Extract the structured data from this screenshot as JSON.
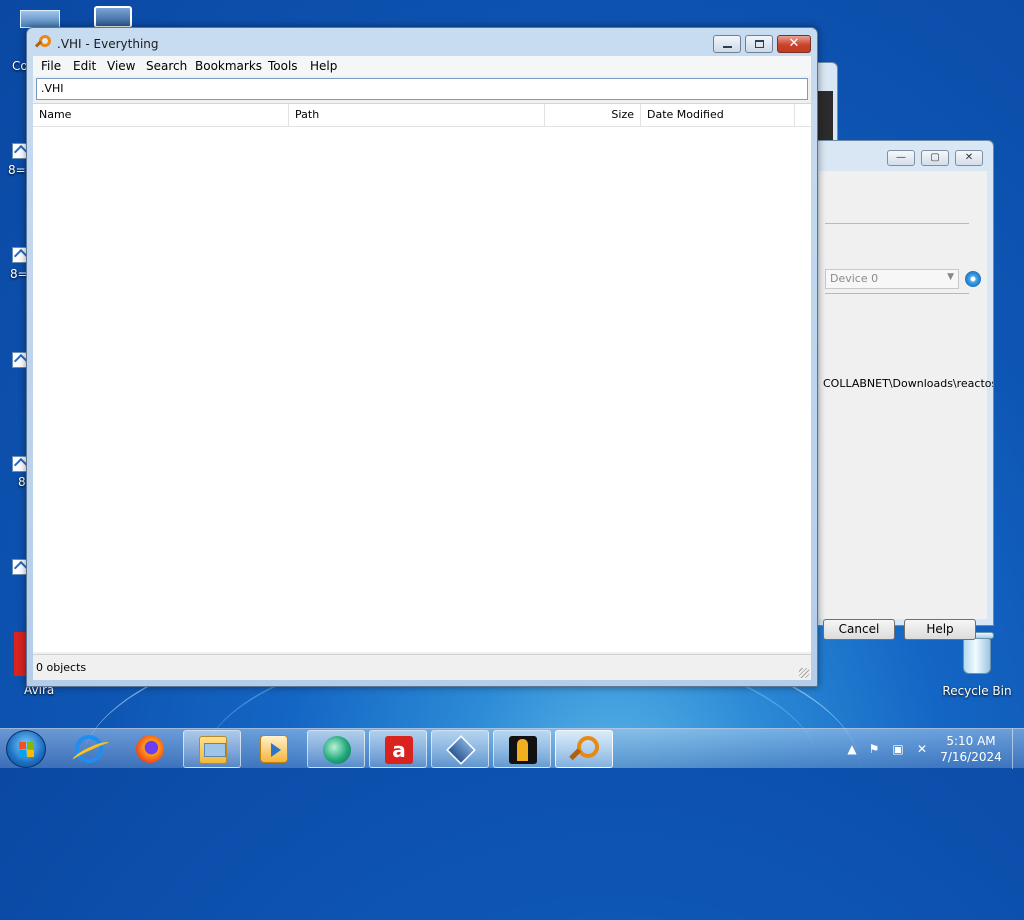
{
  "window": {
    "title": ".VHI - Everything",
    "menu": [
      "File",
      "Edit",
      "View",
      "Search",
      "Bookmarks",
      "Tools",
      "Help"
    ],
    "search_value": ".VHI",
    "columns": [
      "Name",
      "Path",
      "Size",
      "Date Modified"
    ],
    "status": "0 objects"
  },
  "background_dialog": {
    "device_combo": "Device 0",
    "path_text": "COLLABNET\\Downloads\\reactos...",
    "cancel_label": "Cancel",
    "help_label": "Help"
  },
  "desktop": {
    "recycle_bin_label": "Recycle Bin",
    "left_labels": [
      "Co",
      "8=",
      "8=",
      "8",
      "Avira"
    ]
  },
  "taskbar": {
    "apps": [
      "internet-explorer-icon",
      "firefox-icon",
      "file-explorer-icon",
      "media-player-icon",
      "globe-app-icon",
      "avira-icon",
      "virtualbox-icon",
      "tool-app-icon",
      "everything-search-icon"
    ],
    "avira_glyph": "a",
    "time": "5:10 AM",
    "date": "7/16/2024"
  },
  "colors": {
    "title_close": "#c9442d",
    "wallpaper": "#1466c4",
    "everything_orange": "#e88a12"
  }
}
